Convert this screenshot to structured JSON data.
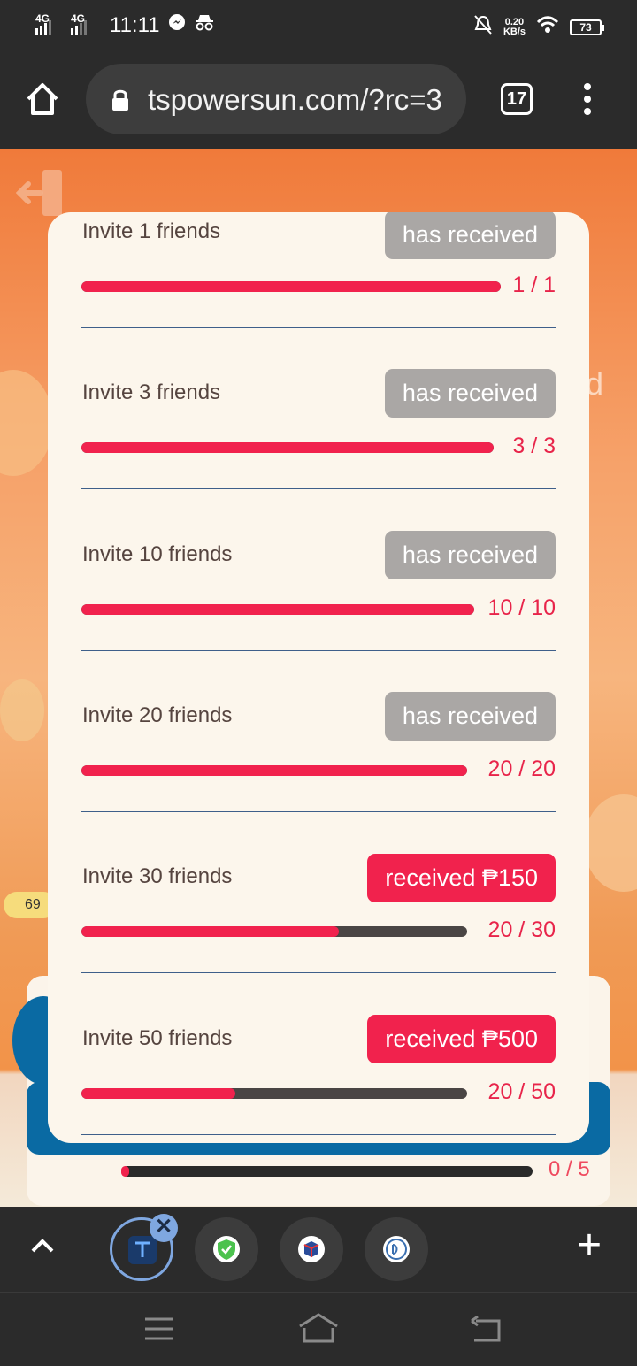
{
  "status_bar": {
    "network1": "4G",
    "network2": "4G",
    "time": "11:11",
    "speed_value": "0.20",
    "speed_unit": "KB/s",
    "battery": "73"
  },
  "browser": {
    "url": "tspowersun.com/?rc=3",
    "tab_count": "17"
  },
  "background": {
    "partial_text": "d",
    "pill_text": "69",
    "progress_label": "0 / 5",
    "progress": 0.02
  },
  "modal": {
    "tasks": [
      {
        "label": "Invite 1 friends",
        "button": "has received",
        "state": "done",
        "count": "1 / 1",
        "progress": 1.0
      },
      {
        "label": "Invite 3 friends",
        "button": "has received",
        "state": "done",
        "count": "3 / 3",
        "progress": 1.0
      },
      {
        "label": "Invite 10 friends",
        "button": "has received",
        "state": "done",
        "count": "10 / 10",
        "progress": 1.0
      },
      {
        "label": "Invite 20 friends",
        "button": "has received",
        "state": "done",
        "count": "20 / 20",
        "progress": 1.0
      },
      {
        "label": "Invite 30 friends",
        "button": "received ₱150",
        "state": "claim",
        "count": "20 / 30",
        "progress": 0.667
      },
      {
        "label": "Invite 50 friends",
        "button": "received ₱500",
        "state": "claim",
        "count": "20 / 50",
        "progress": 0.4
      }
    ]
  },
  "tab_strip": {
    "close_label": "✕",
    "new_tab_label": "+"
  },
  "colors": {
    "accent": "#f1224d",
    "done_button": "#aaa7a5",
    "modal_bg": "#fcf6ec",
    "chrome": "#2b2b2b"
  }
}
